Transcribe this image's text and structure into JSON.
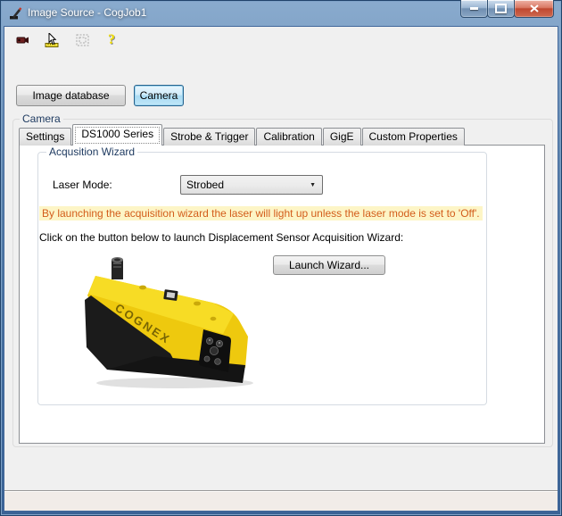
{
  "window": {
    "title": "Image Source - CogJob1"
  },
  "toolbar": {
    "icons": [
      {
        "name": "video-camera-icon"
      },
      {
        "name": "live-display-pointer-ruler-icon"
      },
      {
        "name": "image-region-icon-disabled"
      },
      {
        "name": "help-icon",
        "glyph": "?"
      }
    ]
  },
  "source_selector": {
    "image_database_label": "Image database",
    "camera_label": "Camera",
    "selected": "Camera"
  },
  "camera_group": {
    "label": "Camera"
  },
  "tabs": {
    "selected": "DS1000 Series",
    "items": [
      {
        "label": "Settings"
      },
      {
        "label": "DS1000 Series"
      },
      {
        "label": "Strobe & Trigger"
      },
      {
        "label": "Calibration"
      },
      {
        "label": "GigE"
      },
      {
        "label": "Custom Properties"
      }
    ]
  },
  "acquisition_wizard": {
    "group_label": "Acqusition Wizard",
    "laser_mode_label": "Laser Mode:",
    "laser_mode_value": "Strobed",
    "dropdown_arrow": "▼",
    "warning_text": "By launching the acquisition wizard the laser will light up unless the laser mode is set to 'Off'.",
    "instruction_text": "Click on the button below to launch Displacement Sensor Acquisition Wizard:",
    "launch_button_label": "Launch Wizard...",
    "device_brand": "COGNEX"
  },
  "colors": {
    "titlebar_top": "#8aabce",
    "titlebar_bottom": "#3a6295",
    "close_button_red": "#bf4830",
    "camera_button_fill": "#bfe6f8",
    "camera_button_border": "#26628d",
    "warning_text": "#d35d1b",
    "warning_highlight": "#fdf5c6",
    "device_yellow": "#eec90e",
    "group_label_blue": "#1f3b61"
  }
}
